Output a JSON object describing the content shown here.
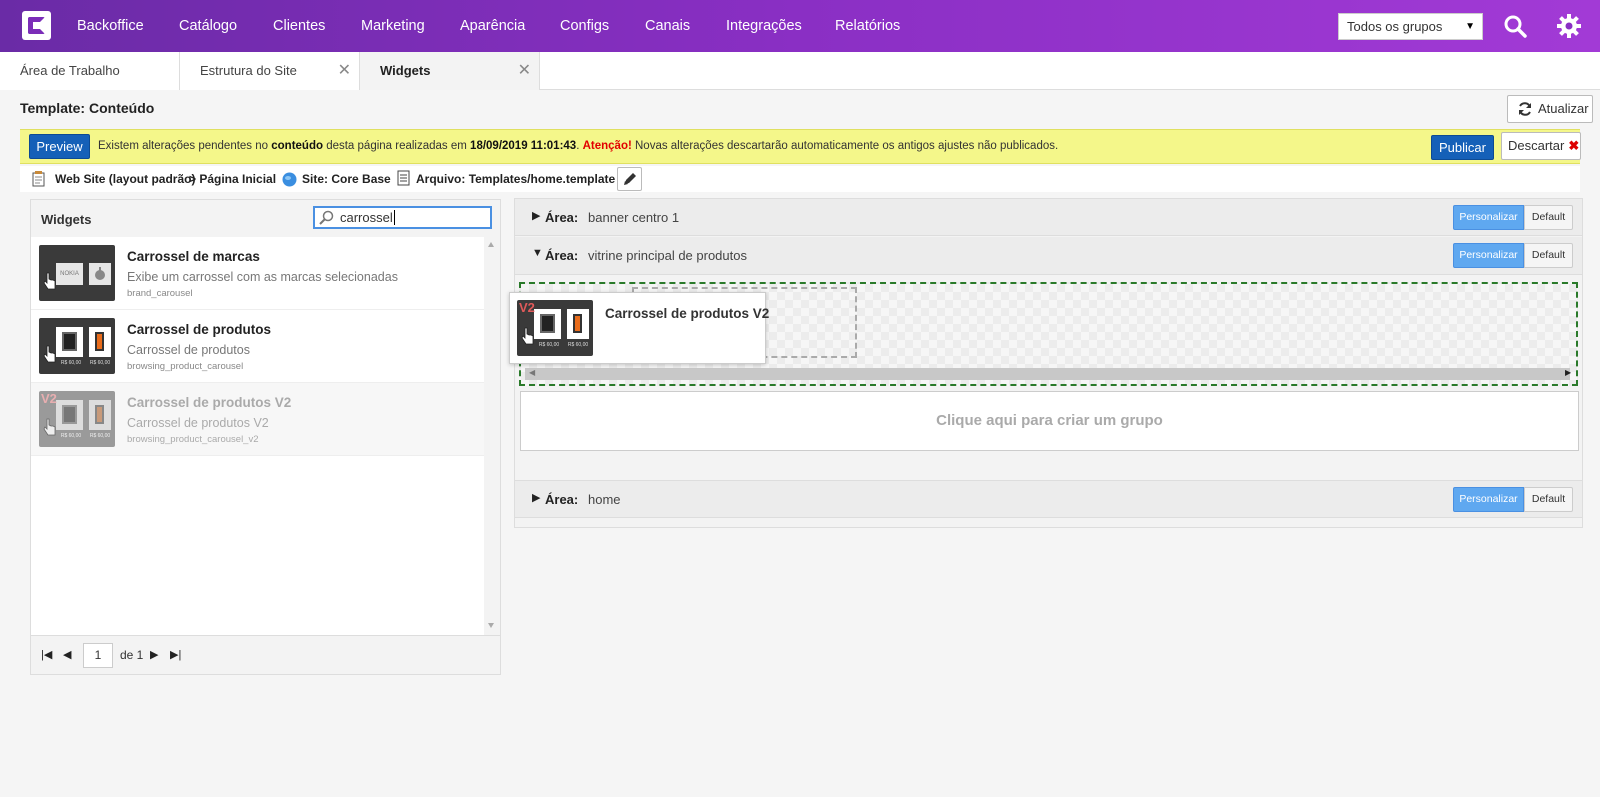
{
  "nav": {
    "items": [
      "Backoffice",
      "Catálogo",
      "Clientes",
      "Marketing",
      "Aparência",
      "Configs",
      "Canais",
      "Integrações",
      "Relatórios"
    ],
    "group_select": "Todos os grupos",
    "accent": "#7b2db8"
  },
  "tabs": [
    {
      "label": "Área de Trabalho",
      "closable": false
    },
    {
      "label": "Estrutura do Site",
      "closable": true
    },
    {
      "label": "Widgets",
      "closable": true,
      "active": true
    }
  ],
  "header": {
    "title": "Template: Conteúdo",
    "refresh_label": "Atualizar"
  },
  "alert": {
    "preview_label": "Preview",
    "text_1": "Existem alterações pendentes no ",
    "bold_1": "conteúdo",
    "text_2": " desta página realizadas em ",
    "bold_2": "18/09/2019 11:01:43",
    "text_3": ". ",
    "warn": "Atenção!",
    "text_4": " Novas alterações descartarão automaticamente os antigos ajustes não publicados.",
    "publish_label": "Publicar",
    "discard_label": "Descartar"
  },
  "crumbs": {
    "layout": "Web Site (layout padrão)",
    "page": "> Página Inicial",
    "site_label": "Site:",
    "site_value": "Core Base",
    "file_label": "Arquivo:",
    "file_value": "Templates/home.template"
  },
  "widgets": {
    "title": "Widgets",
    "search_value": "carrossel",
    "items": [
      {
        "name": "Carrossel de marcas",
        "desc": "Exibe um carrossel com as marcas selecionadas",
        "code": "brand_carousel",
        "disabled": false
      },
      {
        "name": "Carrossel de produtos",
        "desc": "Carrossel de produtos",
        "code": "browsing_product_carousel",
        "disabled": false
      },
      {
        "name": "Carrossel de produtos V2",
        "desc": "Carrossel de produtos V2",
        "code": "browsing_product_carousel_v2",
        "disabled": true
      }
    ],
    "thumb_price": "R$ 60,00",
    "thumb_brand": "NOKIA",
    "thumb_v2": "V2",
    "pager": {
      "page": "1",
      "of": "de 1"
    }
  },
  "areas": {
    "label": "Área:",
    "personalize_label": "Personalizar",
    "default_label": "Default",
    "rows": [
      {
        "name": "banner centro 1",
        "expanded": false
      },
      {
        "name": "vitrine principal de produtos",
        "expanded": true
      },
      {
        "name": "home",
        "expanded": false
      }
    ],
    "create_group": "Clique aqui para criar um grupo"
  },
  "drag_ghost": {
    "name": "Carrossel de produtos V2"
  }
}
